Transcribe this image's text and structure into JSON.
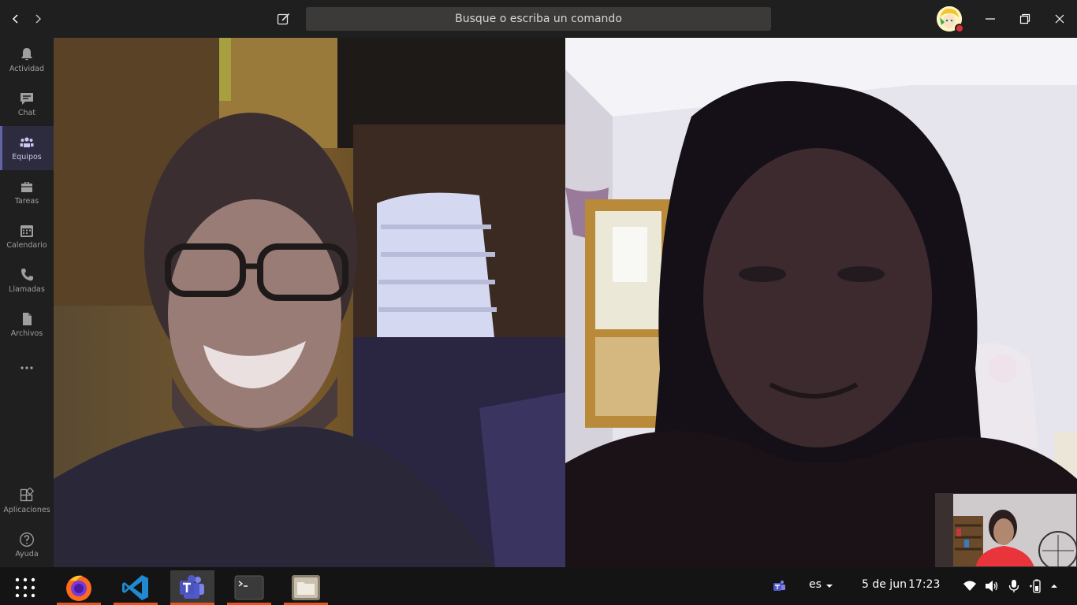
{
  "titlebar": {
    "search_placeholder": "Busque o escriba un comando"
  },
  "rail": {
    "items": [
      {
        "label": "Actividad",
        "icon": "bell-icon"
      },
      {
        "label": "Chat",
        "icon": "chat-icon"
      },
      {
        "label": "Equipos",
        "icon": "teams-icon",
        "active": true
      },
      {
        "label": "Tareas",
        "icon": "briefcase-icon"
      },
      {
        "label": "Calendario",
        "icon": "calendar-icon"
      },
      {
        "label": "Llamadas",
        "icon": "phone-icon"
      },
      {
        "label": "Archivos",
        "icon": "file-icon"
      },
      {
        "label": "...",
        "icon": "more-icon"
      }
    ],
    "bottom": [
      {
        "label": "Aplicaciones",
        "icon": "apps-icon"
      },
      {
        "label": "Ayuda",
        "icon": "help-icon"
      }
    ]
  },
  "taskbar": {
    "apps": [
      "show-apps-grid",
      "firefox",
      "vscode",
      "teams",
      "terminal",
      "files"
    ],
    "language": "es",
    "date": "5 de jun",
    "time": "17:23"
  },
  "colors": {
    "teams_accent": "#6264a7",
    "ubuntu_orange": "#e95420",
    "presence_busy": "#e0303a"
  }
}
